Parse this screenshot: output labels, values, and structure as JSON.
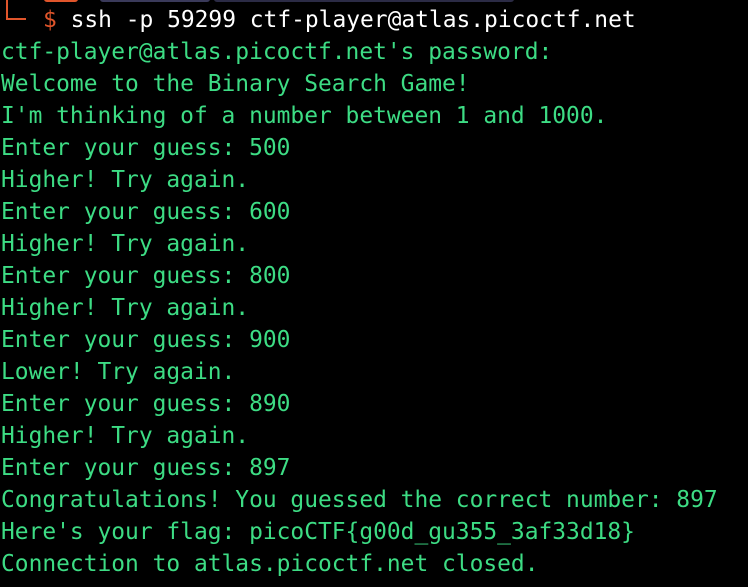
{
  "terminal": {
    "prompt_symbol": "$",
    "command": "ssh -p 59299 ctf-player@atlas.picoctf.net",
    "output_lines": [
      "ctf-player@atlas.picoctf.net's password:",
      "Welcome to the Binary Search Game!",
      "I'm thinking of a number between 1 and 1000.",
      "Enter your guess: 500",
      "Higher! Try again.",
      "Enter your guess: 600",
      "Higher! Try again.",
      "Enter your guess: 800",
      "Higher! Try again.",
      "Enter your guess: 900",
      "Lower! Try again.",
      "Enter your guess: 890",
      "Higher! Try again.",
      "Enter your guess: 897",
      "Congratulations! You guessed the correct number: 897",
      "Here's your flag: picoCTF{g00d_gu355_3af33d18}",
      "Connection to atlas.picoctf.net closed."
    ]
  },
  "colors": {
    "background": "#000000",
    "output_text": "#3ddc84",
    "command_text": "#ffffff",
    "prompt_accent": "#e0552b"
  }
}
